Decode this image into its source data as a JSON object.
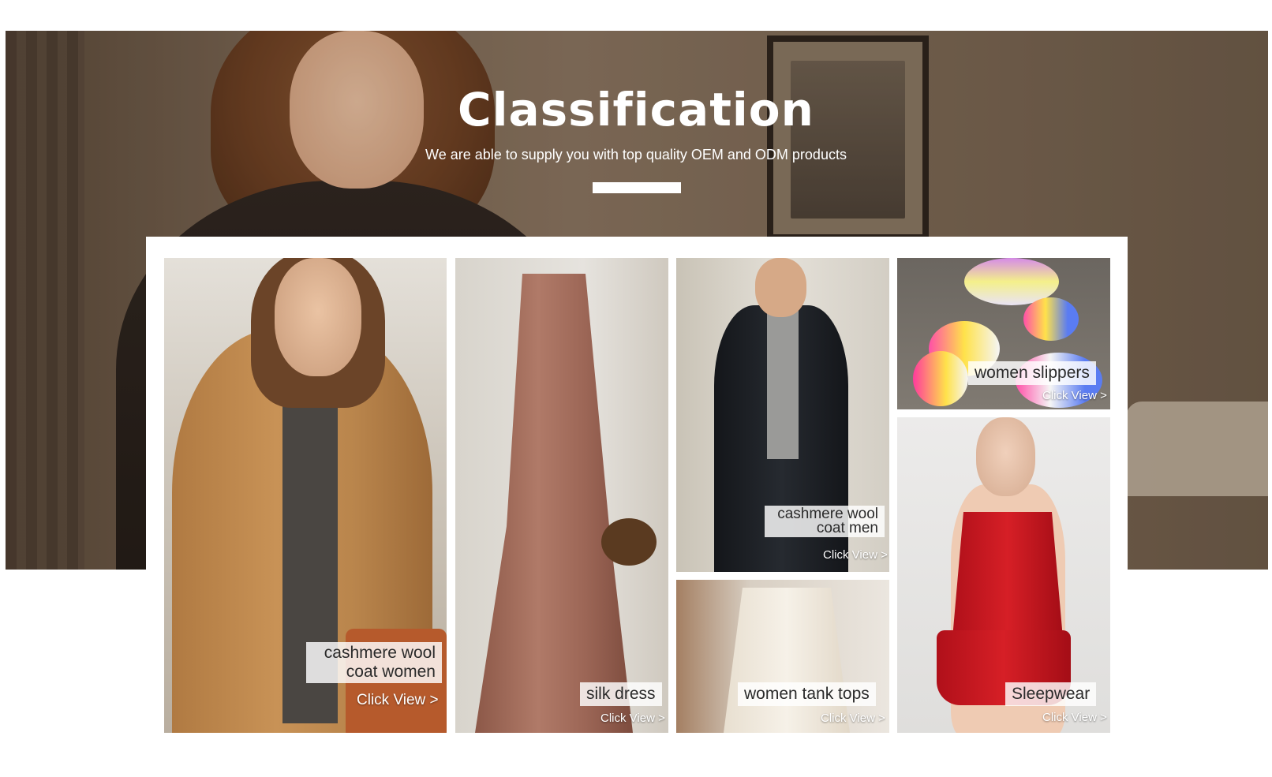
{
  "header": {
    "title": "Classification",
    "subtitle": "We are able to supply you with top quality OEM and ODM products"
  },
  "categories": [
    {
      "label_line1": "cashmere wool",
      "label_line2": "coat women",
      "cta": "Click View >"
    },
    {
      "label": "silk dress",
      "cta": "Click View >"
    },
    {
      "label_line1": "cashmere wool",
      "label_line2": "coat men",
      "cta": "Click View >"
    },
    {
      "label": "women tank tops",
      "cta": "Click View >"
    },
    {
      "label": "women slippers",
      "cta": "Click View >"
    },
    {
      "label": "Sleepwear",
      "cta": "Click View >"
    }
  ],
  "colors": {
    "title_text": "#ffffff",
    "caption_background": "#ffffff",
    "caption_text": "#2a2a2a",
    "cta_text": "#ffffff"
  }
}
